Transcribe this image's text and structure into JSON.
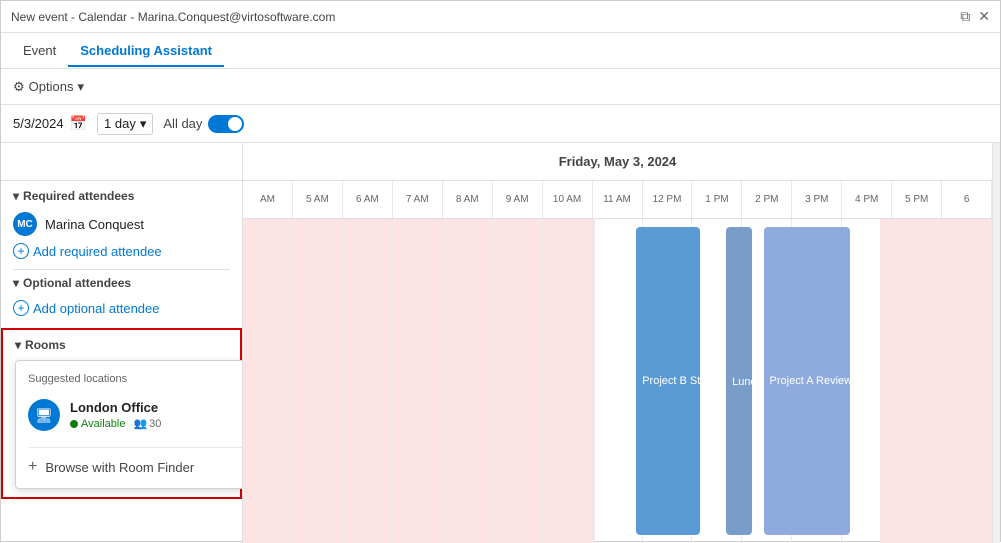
{
  "titleBar": {
    "title": "New event - Calendar - Marina.Conquest@virtosoftware.com",
    "controls": [
      "restore-icon",
      "close-icon"
    ]
  },
  "tabs": [
    {
      "id": "event",
      "label": "Event",
      "active": false
    },
    {
      "id": "scheduling-assistant",
      "label": "Scheduling Assistant",
      "active": true
    }
  ],
  "optionsBar": {
    "label": "Options",
    "chevron": "▾"
  },
  "dateBar": {
    "date": "5/3/2024",
    "dayView": "1 day",
    "allDayLabel": "All day",
    "allDayEnabled": true
  },
  "calendarHeader": {
    "dateLabel": "Friday, May 3, 2024"
  },
  "timeSlots": [
    "AM",
    "5 AM",
    "6 AM",
    "7 AM",
    "8 AM",
    "9 AM",
    "10 AM",
    "11 AM",
    "12 PM",
    "1 PM",
    "2 PM",
    "3 PM",
    "4 PM",
    "5 PM",
    "6"
  ],
  "attendees": {
    "requiredLabel": "Required attendees",
    "persons": [
      {
        "name": "Marina Conquest",
        "initials": "MC"
      }
    ],
    "addRequiredLabel": "Add required attendee",
    "optionalLabel": "Optional attendees",
    "addOptionalLabel": "Add optional attendee"
  },
  "rooms": {
    "label": "Rooms",
    "suggestedTitle": "Suggested locations",
    "locations": [
      {
        "name": "London Office",
        "available": "Available",
        "capacity": "30",
        "icon": "🖥"
      }
    ],
    "browseLabel": "Browse with Room Finder"
  },
  "events": [
    {
      "title": "Project B Stakehol",
      "color": "#5b9bd5",
      "startPct": 52.5,
      "widthPct": 8.5
    },
    {
      "title": "Lunc 🔄",
      "color": "#7a9cc9",
      "startPct": 64.5,
      "widthPct": 3.5
    },
    {
      "title": "Project A Review of Wee",
      "color": "#8faadc",
      "startPct": 69.5,
      "widthPct": 11.5
    }
  ],
  "unavailableRanges": [
    {
      "startPct": 0,
      "widthPct": 47
    },
    {
      "startPct": 85,
      "widthPct": 15
    }
  ]
}
